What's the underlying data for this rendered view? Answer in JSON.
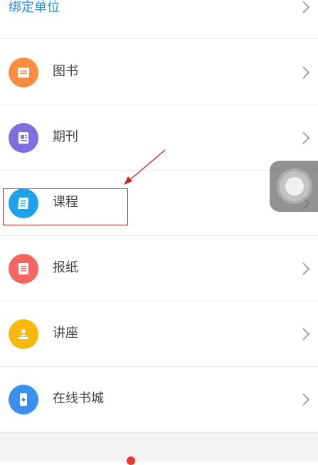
{
  "top_item": {
    "label": "绑定单位"
  },
  "menu": {
    "items": [
      {
        "label": "图书",
        "icon": "book-icon",
        "color": "#f98c3d"
      },
      {
        "label": "期刊",
        "icon": "journal-icon",
        "color": "#7f6ee0"
      },
      {
        "label": "课程",
        "icon": "course-icon",
        "color": "#1fa2e8"
      },
      {
        "label": "报纸",
        "icon": "newspaper-icon",
        "color": "#f4665f"
      },
      {
        "label": "讲座",
        "icon": "lecture-icon",
        "color": "#f6b80a"
      },
      {
        "label": "在线书城",
        "icon": "online-bookstore-icon",
        "color": "#3a8ff0"
      }
    ]
  },
  "colors": {
    "top_label": "#2a8be0",
    "annotation": "#c62828"
  }
}
